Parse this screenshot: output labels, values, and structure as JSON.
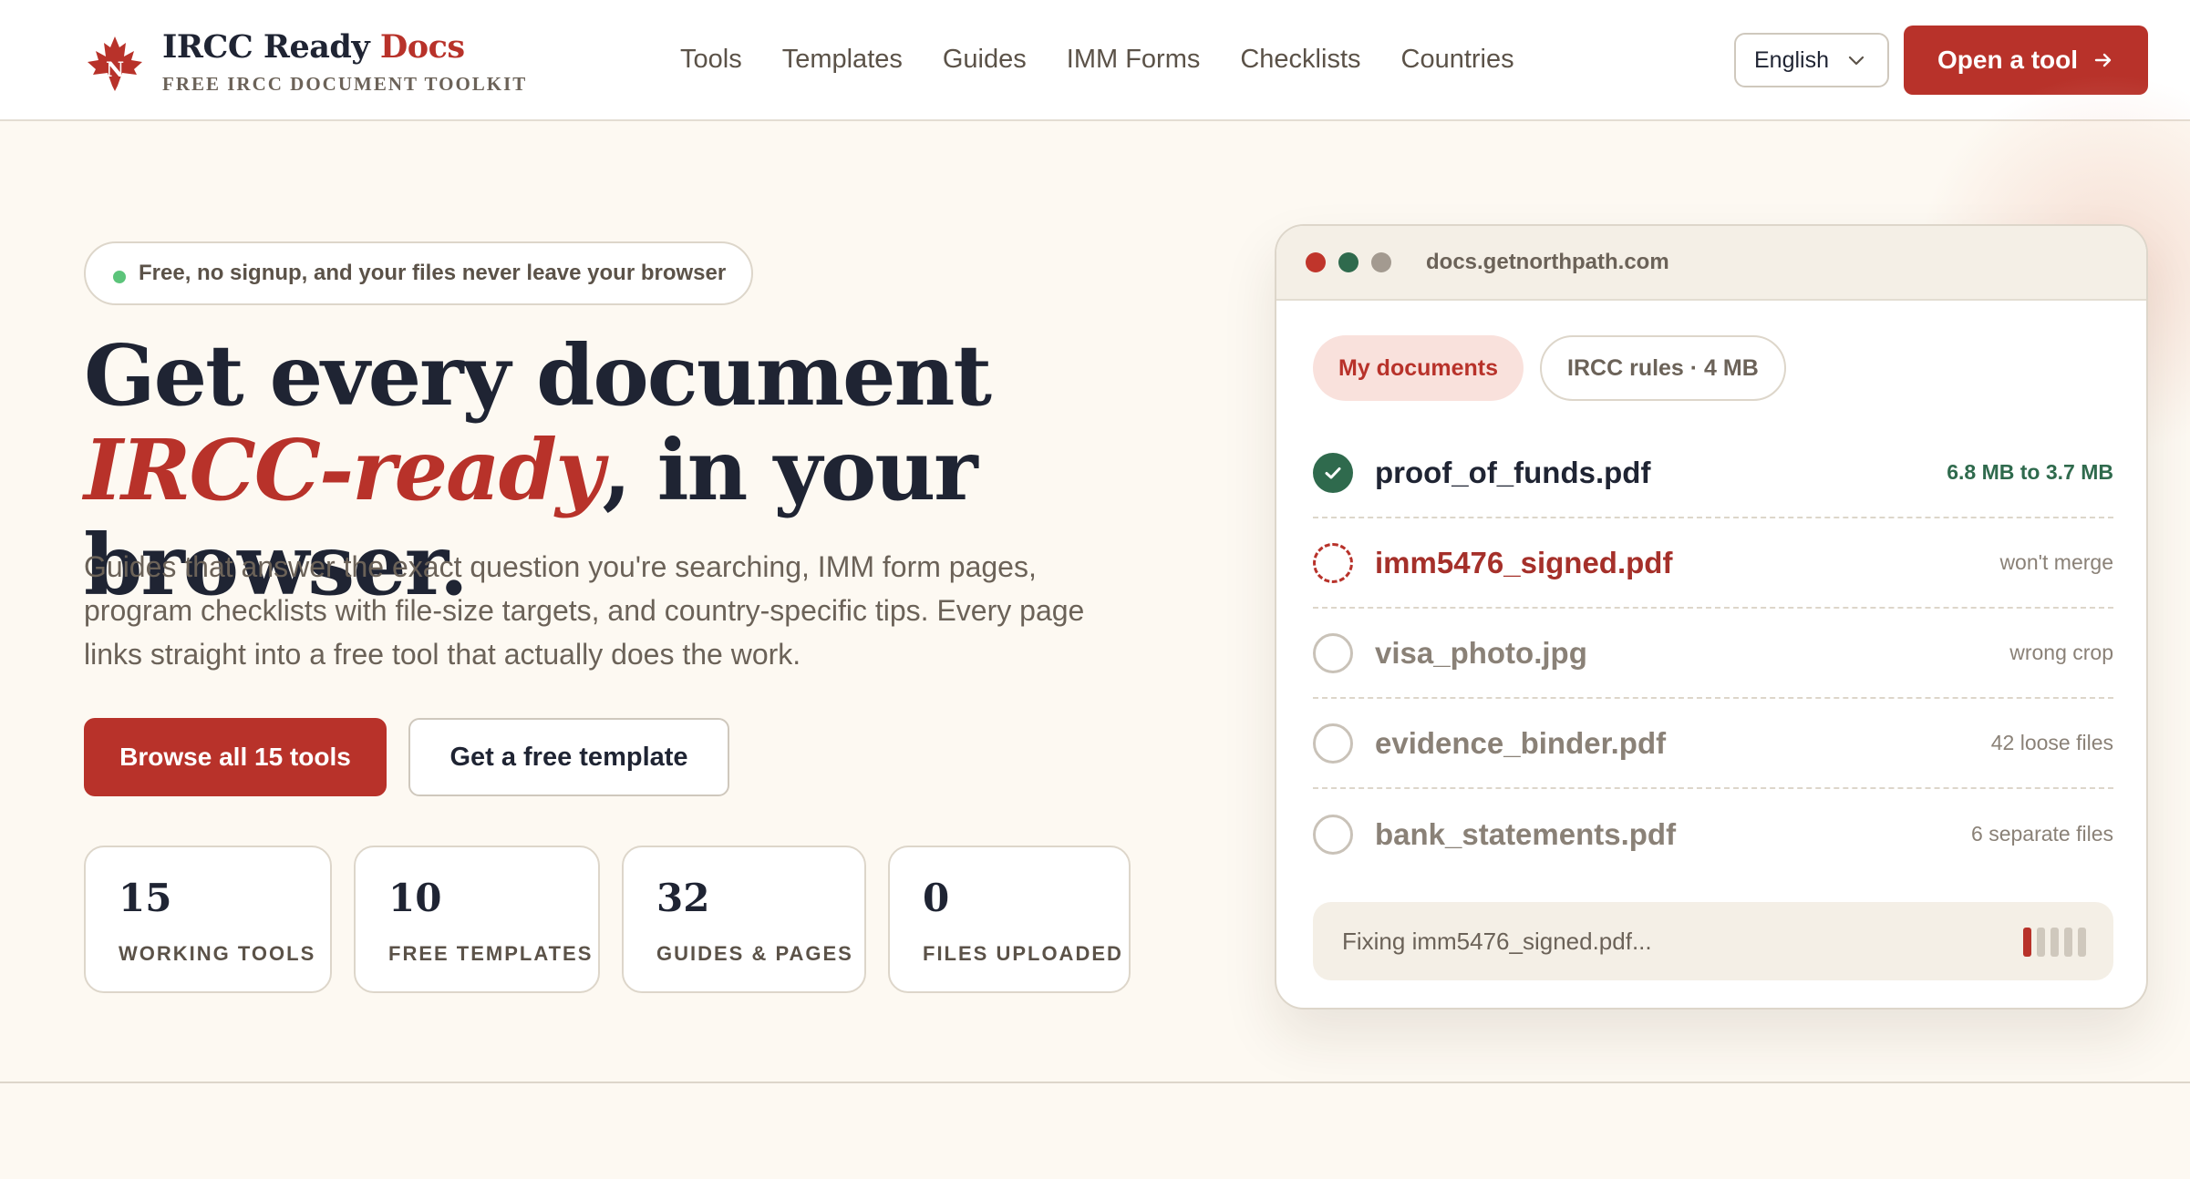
{
  "brand": {
    "title_main": "IRCC Ready ",
    "title_accent": "Docs",
    "subtitle": "FREE IRCC DOCUMENT TOOLKIT",
    "accent_color": "#b8322a"
  },
  "nav": {
    "items": [
      "Tools",
      "Templates",
      "Guides",
      "IMM Forms",
      "Checklists",
      "Countries"
    ]
  },
  "header": {
    "language": "English",
    "cta_label": "Open a tool"
  },
  "hero": {
    "pill_text": "Free, no signup, and your files never leave your browser",
    "headline_part1": "Get every document ",
    "headline_accent": "IRCC-ready",
    "headline_part2": ", in your browser.",
    "lede": "Guides that answer the exact question you're searching, IMM form pages, program checklists with file-size targets, and country-specific tips. Every page links straight into a free tool that actually does the work.",
    "primary_button": "Browse all 15 tools",
    "secondary_button": "Get a free template"
  },
  "stats": [
    {
      "value": "15",
      "label": "WORKING TOOLS"
    },
    {
      "value": "10",
      "label": "FREE TEMPLATES"
    },
    {
      "value": "32",
      "label": "GUIDES & PAGES"
    },
    {
      "value": "0",
      "label": "FILES UPLOADED"
    }
  ],
  "mock": {
    "url": "docs.getnorthpath.com",
    "tabs": [
      "My documents",
      "IRCC rules · 4 MB"
    ],
    "files": [
      {
        "name": "proof_of_funds.pdf",
        "note": "6.8 MB to 3.7 MB",
        "state": "done"
      },
      {
        "name": "imm5476_signed.pdf",
        "note": "won't merge",
        "state": "active"
      },
      {
        "name": "visa_photo.jpg",
        "note": "wrong crop",
        "state": "pending"
      },
      {
        "name": "evidence_binder.pdf",
        "note": "42 loose files",
        "state": "pending"
      },
      {
        "name": "bank_statements.pdf",
        "note": "6 separate files",
        "state": "pending"
      }
    ],
    "progress_text": "Fixing imm5476_signed.pdf...",
    "progress_fraction": 0.2
  }
}
